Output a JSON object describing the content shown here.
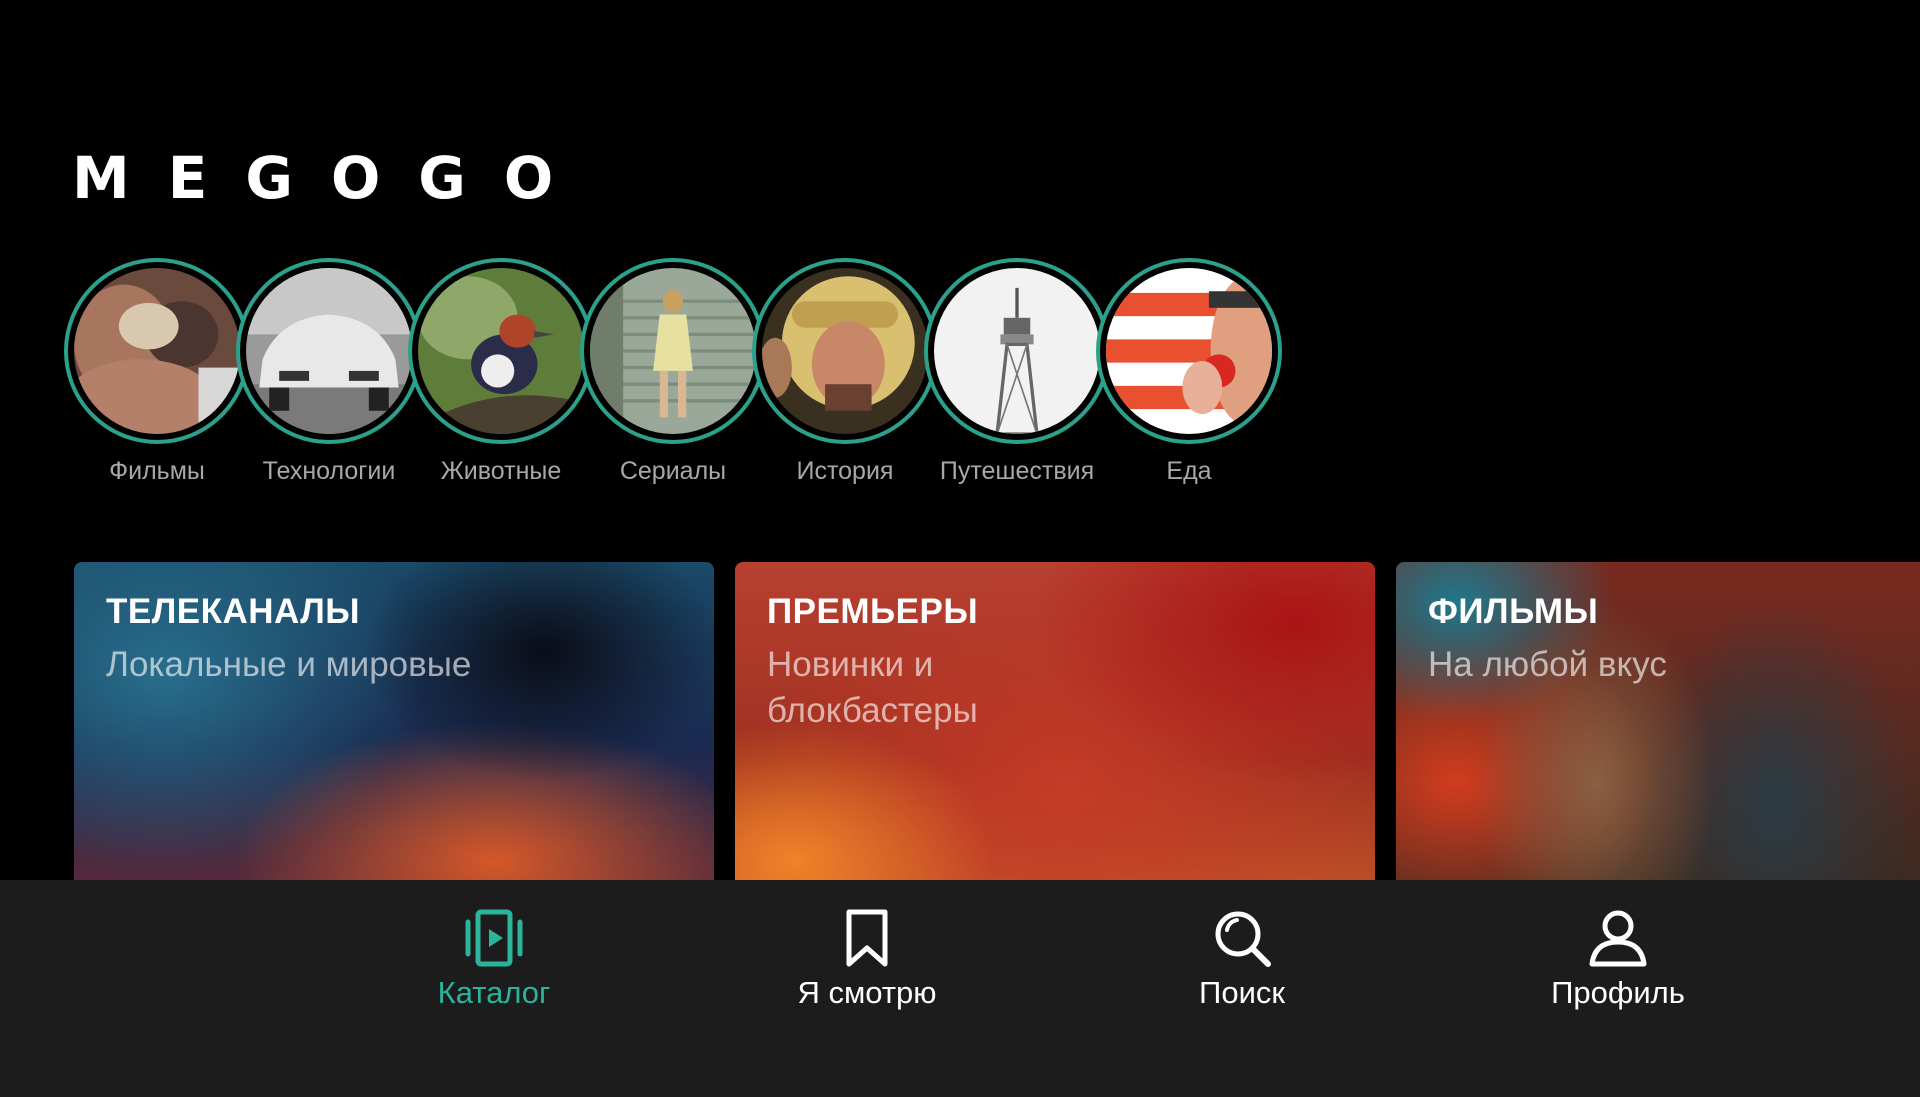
{
  "app": {
    "logo": "MEGOGO"
  },
  "stories": [
    {
      "label": "Фильмы",
      "icon": "couple-photo"
    },
    {
      "label": "Технологии",
      "icon": "car-photo"
    },
    {
      "label": "Животные",
      "icon": "bird-photo"
    },
    {
      "label": "Сериалы",
      "icon": "stairs-woman-photo"
    },
    {
      "label": "История",
      "icon": "aviator-photo"
    },
    {
      "label": "Путешествия",
      "icon": "tower-photo"
    },
    {
      "label": "Еда",
      "icon": "tomato-photo"
    }
  ],
  "cards": [
    {
      "title": "ТЕЛЕКАНАЛЫ",
      "subtitle": "Локальные и мировые"
    },
    {
      "title": "ПРЕМЬЕРЫ",
      "subtitle": "Новинки и блокбастеры"
    },
    {
      "title": "ФИЛЬМЫ",
      "subtitle": "На любой вкус"
    }
  ],
  "nav": [
    {
      "label": "Каталог",
      "icon": "catalog-icon",
      "active": true
    },
    {
      "label": "Я смотрю",
      "icon": "bookmark-icon",
      "active": false
    },
    {
      "label": "Поиск",
      "icon": "search-icon",
      "active": false
    },
    {
      "label": "Профиль",
      "icon": "profile-icon",
      "active": false
    }
  ],
  "colors": {
    "accent": "#2bb39c",
    "ring": "#2ba18c",
    "nav_background": "#1c1c1c",
    "background": "#000000"
  }
}
